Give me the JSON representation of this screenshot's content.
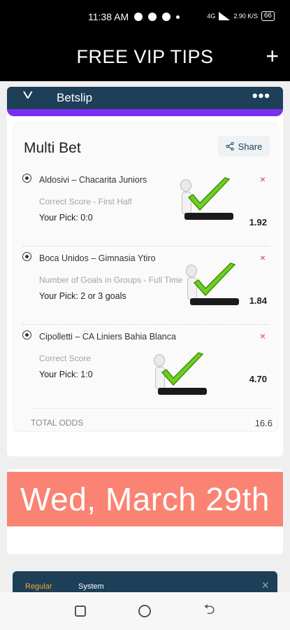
{
  "status_bar": {
    "time": "11:38 AM",
    "network": "4G",
    "speed": "2.90 K/S",
    "battery": "66"
  },
  "app": {
    "title": "FREE VIP TIPS",
    "add_icon": "plus-icon"
  },
  "betslip": {
    "header_title": "Betslip",
    "multi_bet_title": "Multi Bet",
    "share_label": "Share",
    "bets": [
      {
        "match": "Aldosivi – Chacarita Juniors",
        "market": "Correct Score - First Half",
        "pick": "Your Pick: 0:0",
        "odds": "1.92"
      },
      {
        "match": "Boca Unidos – Gimnasia Ytiro",
        "market": "Number of Goals in Groups - Full Time",
        "pick": "Your Pick: 2 or 3 goals",
        "odds": "1.84"
      },
      {
        "match": "Cipolletti – CA Liniers Bahia Blanca",
        "market": "Correct Score",
        "pick": "Your Pick: 1:0",
        "odds": "4.70"
      }
    ],
    "total_label": "TOTAL ODDS",
    "total_value": "16.6"
  },
  "date_banner": "Wed, March 29th",
  "next_slip": {
    "tab_regular": "Regular",
    "tab_system": "System"
  },
  "colors": {
    "app_bar": "#000000",
    "slip_header": "#1d3f58",
    "slip_accent": "#7b2ff0",
    "banner": "#fa8373",
    "check": "#6fcf1f",
    "remove": "#e04040"
  }
}
